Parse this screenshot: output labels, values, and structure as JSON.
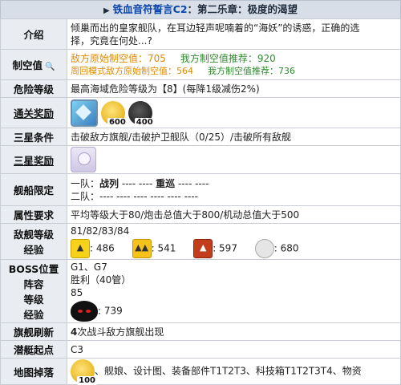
{
  "title": {
    "arrow": "▶",
    "name": "铁血音符誓言C2",
    "subtitle": "：第二乐章：极度的渴望"
  },
  "rows": {
    "intro": {
      "label": "介绍",
      "text_line1": "倾巢而出的皇家舰队，在耳边轻声呢喃着的“海妖”的诱惑，正确的选",
      "text_line2": "择，究竟在何处...?"
    },
    "air": {
      "label": "制空值",
      "enemy_label": "敌方原始制空值：705",
      "recommend_label": "我方制空值推荐：920",
      "cycle_label": "周回模式敌方原始制空值：564",
      "cycle_recommend": "我方制空值推荐：736"
    },
    "danger": {
      "label": "危险等级",
      "text": "最高海域危险等级为【8】(每降1级减伤2%)"
    },
    "reward": {
      "label": "通关奖励",
      "coin_count": "600",
      "oil_count": "400"
    },
    "stars": {
      "label": "三星条件",
      "text": "击破敌方旗舰/击破护卫舰队（0/25）/击破所有敌舰"
    },
    "star_reward": {
      "label": "三星奖励"
    },
    "limit": {
      "label": "舰船限定",
      "fleet1_prefix": "一队：",
      "fleet1_main": "战列",
      "fleet1_mid": "---- ---- ",
      "fleet1_cruiser": "重巡",
      "fleet1_end": " ---- ----",
      "fleet2": "二队：---- ---- ---- ---- ---- ----"
    },
    "attr": {
      "label": "属性要求",
      "text": "平均等级大于80/炮击总值大于800/机动总值大于500"
    },
    "enemy": {
      "label_line1": "敌舰等级",
      "label_line2": "经验",
      "levels": "81/82/83/84",
      "exp": [
        ": 486",
        ": 541",
        ": 597",
        ": 680"
      ]
    },
    "boss": {
      "label_line1": "BOSS位置",
      "label_line2": "阵容",
      "label_line3": "等级",
      "label_line4": "经验",
      "pos": "G1、G7",
      "fleet": "胜利（40管）",
      "level": "85",
      "exp": ": 739"
    },
    "flagship": {
      "label": "旗舰刷新",
      "count": "4",
      "text": "次战斗敌方旗舰出现"
    },
    "sub": {
      "label": "潜艇起点",
      "text": "C3"
    },
    "drops": {
      "label": "地图掉落",
      "badge": "100",
      "text": "、舰娘、设计图、装备部件T1T2T3、科技箱T1T2T3T4、物资"
    }
  },
  "icons": {
    "box": "gem-box-icon",
    "coin": "coin-icon",
    "oil": "oil-icon",
    "char": "character-portrait-icon"
  }
}
